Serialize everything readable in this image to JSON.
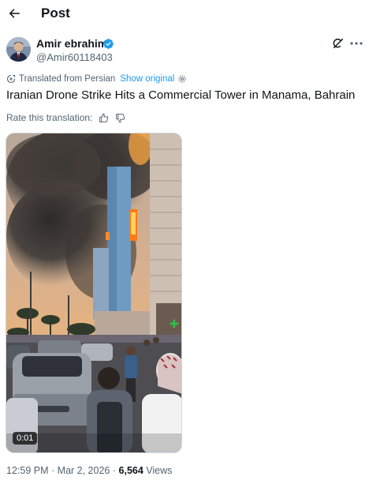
{
  "header": {
    "title": "Post",
    "back_icon": "back-arrow-icon"
  },
  "author": {
    "name": "Amir ebrahimi",
    "handle": "@Amir60118403",
    "verified": true,
    "verified_color": "#1d9bf0"
  },
  "translation": {
    "label": "Translated from Persian",
    "show_original": "Show original",
    "rate_label": "Rate this translation:"
  },
  "tweet": {
    "text": "Iranian Drone Strike Hits a Commercial Tower in Manama, Bahrain"
  },
  "media": {
    "type": "video",
    "duration": "0:01"
  },
  "meta": {
    "time": "12:59 PM",
    "separator": "·",
    "date": "Mar 2, 2026",
    "views_count": "6,564",
    "views_label": "Views"
  },
  "colors": {
    "accent": "#1d9bf0",
    "text": "#0f1419",
    "secondary": "#536471"
  }
}
